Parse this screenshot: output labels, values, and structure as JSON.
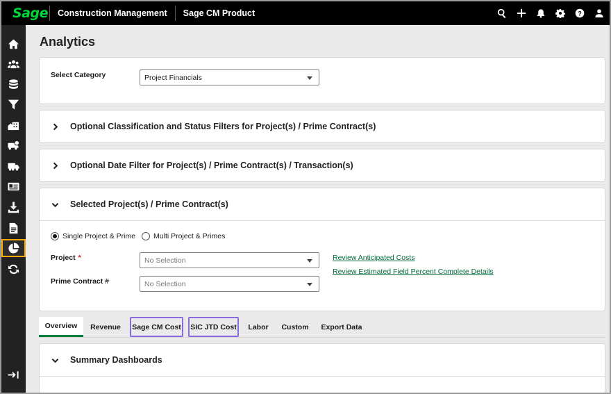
{
  "topbar": {
    "logo": "Sage",
    "app_name": "Construction Management",
    "product_name": "Sage CM Product",
    "icons": [
      "search-icon",
      "plus-icon",
      "bell-icon",
      "gear-icon",
      "help-icon",
      "user-icon"
    ]
  },
  "sidebar": {
    "items": [
      "home-icon",
      "people-icon",
      "database-icon",
      "filter-icon",
      "buildings-icon",
      "truck-dollar-icon",
      "truck-icon",
      "id-card-icon",
      "download-icon",
      "document-icon",
      "pie-chart-icon",
      "refresh-icon"
    ],
    "active": "pie-chart-icon",
    "collapse_icon": "expand-sidebar-icon"
  },
  "page": {
    "title": "Analytics"
  },
  "category": {
    "label": "Select Category",
    "value": "Project Financials"
  },
  "accordions": {
    "classification": "Optional Classification and Status Filters for Project(s) / Prime Contract(s)",
    "date": "Optional Date Filter for Project(s) / Prime Contract(s) / Transaction(s)",
    "selected": "Selected Project(s) / Prime Contract(s)"
  },
  "selection": {
    "radio_single": "Single Project & Prime",
    "radio_multi": "Multi Project & Primes",
    "selected_radio": "single",
    "project_label": "Project",
    "required_mark": "*",
    "project_placeholder": "No Selection",
    "prime_label": "Prime Contract #",
    "prime_placeholder": "No Selection",
    "link_anticipated": "Review Anticipated Costs",
    "link_field_percent": "Review Estimated Field Percent Complete Details"
  },
  "tabs": {
    "items": [
      "Overview",
      "Revenue",
      "Sage CM Cost",
      "SIC JTD Cost",
      "Labor",
      "Custom",
      "Export Data"
    ],
    "active": "Overview",
    "highlighted": [
      "Sage CM Cost",
      "SIC JTD Cost"
    ]
  },
  "summary": {
    "title": "Summary Dashboards"
  },
  "colors": {
    "brand_green": "#00d639",
    "link_green": "#00693b",
    "tab_active": "#00823c",
    "highlight_purple": "#8a6ce0",
    "active_sidebar": "#f5a900"
  }
}
